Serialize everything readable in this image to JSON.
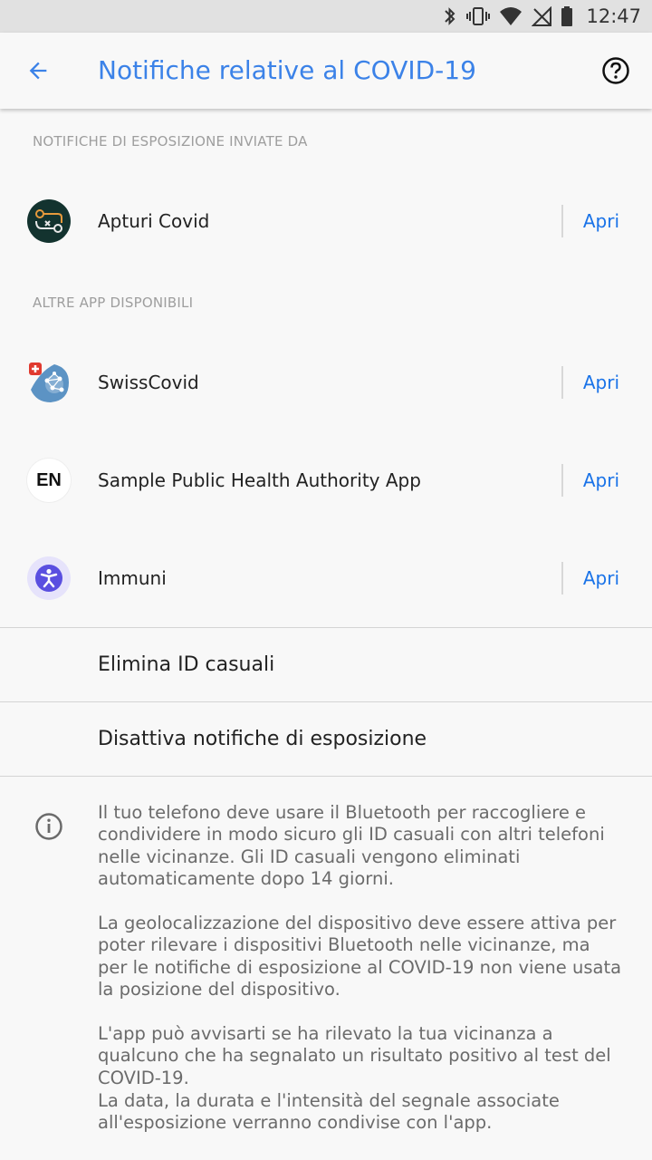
{
  "status_bar": {
    "time": "12:47",
    "icons": [
      "bluetooth-icon",
      "vibrate-icon",
      "wifi-icon",
      "no-signal-icon",
      "battery-icon"
    ]
  },
  "app_bar": {
    "title": "Notifiche relative al COVID-19",
    "back_icon": "arrow-back-icon",
    "help_icon": "help-icon",
    "accent_color": "#3b82e8"
  },
  "sections": {
    "sent_by_header": "NOTIFICHE DI ESPOSIZIONE INVIATE DA",
    "other_apps_header": "ALTRE APP DISPONIBILI"
  },
  "active_app": {
    "name": "Apturi Covid",
    "open_label": "Apri",
    "icon": "apturi-covid-icon"
  },
  "other_apps": [
    {
      "name": "SwissCovid",
      "open_label": "Apri",
      "icon": "swisscovid-icon"
    },
    {
      "name": "Sample Public Health Authority App",
      "open_label": "Apri",
      "icon": "en-icon",
      "icon_text": "EN"
    },
    {
      "name": "Immuni",
      "open_label": "Apri",
      "icon": "immuni-icon"
    }
  ],
  "actions": {
    "delete_ids": "Elimina ID casuali",
    "disable_notifications": "Disattiva notifiche di esposizione"
  },
  "info": {
    "icon": "info-icon",
    "paragraphs": [
      "Il tuo telefono deve usare il Bluetooth per raccogliere e condividere in modo sicuro gli ID casuali con altri telefoni nelle vicinanze. Gli ID casuali vengono eliminati automaticamente dopo 14 giorni.",
      "La geolocalizzazione del dispositivo deve essere attiva per poter rilevare i dispositivi Bluetooth nelle vicinanze, ma per le notifiche di esposizione al COVID-19 non viene usata la posizione del dispositivo.",
      "L'app può avvisarti se ha rilevato la tua vicinanza a qualcuno che ha segnalato un risultato positivo al test del COVID-19.",
      "La data, la durata e l'intensità del segnale associate all'esposizione verranno condivise con l'app."
    ]
  },
  "colors": {
    "link": "#1a73e8",
    "background": "#f8f8f8",
    "status_bar": "#e1e1e1"
  }
}
